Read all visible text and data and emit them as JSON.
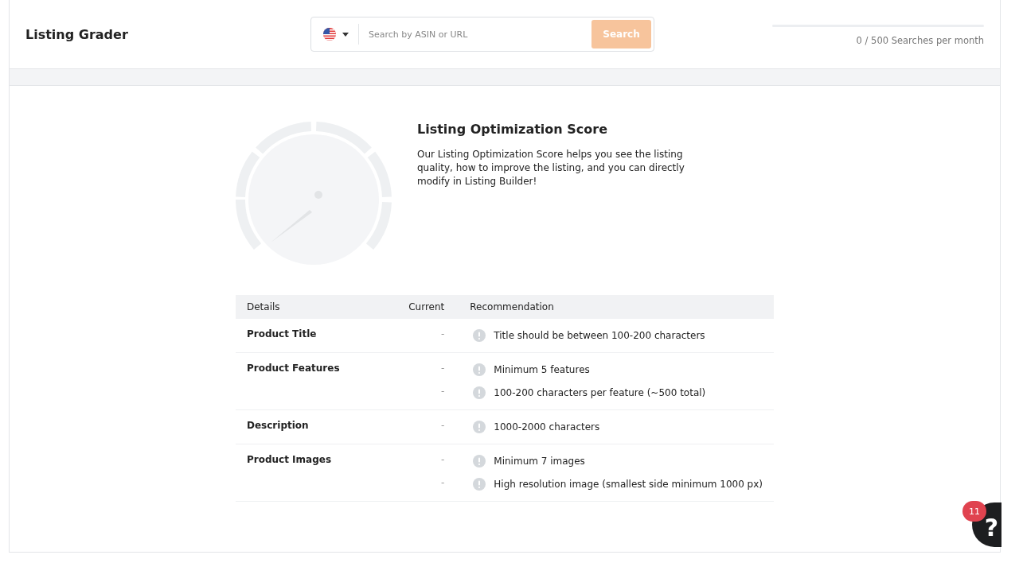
{
  "header": {
    "title": "Listing Grader",
    "search": {
      "placeholder": "Search by ASIN or URL",
      "button": "Search",
      "disabled": true
    },
    "usage": {
      "level": 0,
      "text": "0 / 500 Searches per month"
    }
  },
  "score": {
    "title": "Listing Optimization Score",
    "description": "Our Listing Optimization Score helps you see the listing quality, how to improve the listing, and you can directly modify in Listing Builder!"
  },
  "table": {
    "columns": [
      "Details",
      "Current",
      "Recommendation"
    ],
    "rows": [
      {
        "detail": "Product Title",
        "items": [
          {
            "current": "-",
            "recommendation": "Title should be between 100-200 characters"
          }
        ]
      },
      {
        "detail": "Product Features",
        "items": [
          {
            "current": "-",
            "recommendation": "Minimum 5 features"
          },
          {
            "current": "-",
            "recommendation": "100-200 characters per feature (~500 total)"
          }
        ]
      },
      {
        "detail": "Description",
        "items": [
          {
            "current": "-",
            "recommendation": "1000-2000 characters"
          }
        ]
      },
      {
        "detail": "Product Images",
        "items": [
          {
            "current": "-",
            "recommendation": "Minimum 7 images"
          },
          {
            "current": "-",
            "recommendation": "High resolution image (smallest side minimum 1000 px)"
          }
        ]
      }
    ]
  },
  "help": {
    "label": "?",
    "badge": "11"
  }
}
